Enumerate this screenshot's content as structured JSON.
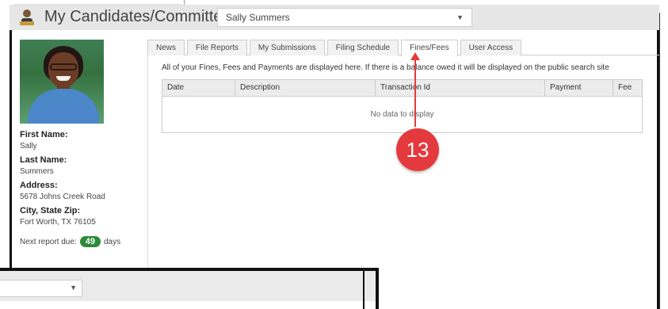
{
  "header": {
    "title": "My Candidates/Committees",
    "selected_committee": "Sally Summers",
    "logo_icon": "candidate-logo-icon"
  },
  "profile": {
    "first_name_label": "First Name:",
    "first_name": "Sally",
    "last_name_label": "Last Name:",
    "last_name": "Summers",
    "address_label": "Address:",
    "address": "5678 Johns Creek Road",
    "city_label": "City, State Zip:",
    "city": "Fort Worth, TX 76105",
    "next_report_label": "Next report due:",
    "next_report_days": "49",
    "next_report_unit": "days"
  },
  "tabs": [
    "News",
    "File Reports",
    "My Submissions",
    "Filing Schedule",
    "Fines/Fees",
    "User Access"
  ],
  "active_tab": "Fines/Fees",
  "fines": {
    "notice": "All of your Fines, Fees and Payments are displayed here. If there is a balance owed it will be displayed on the public search site",
    "columns": [
      "Date",
      "Description",
      "Transaction Id",
      "Payment",
      "Fee"
    ],
    "empty_text": "No data to display"
  },
  "callout": {
    "number": "13",
    "color": "#e53a3d"
  },
  "colors": {
    "badge": "#2d8a3a",
    "header_bg": "#e6e6e6"
  }
}
